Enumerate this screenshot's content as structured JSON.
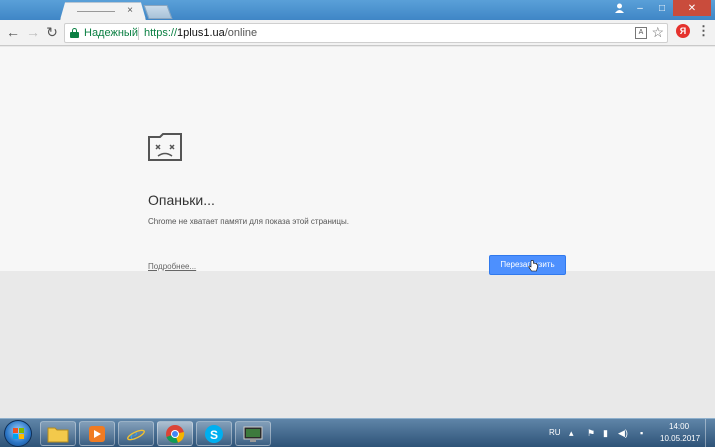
{
  "browser": {
    "tab": {
      "title": "",
      "close_glyph": "×"
    },
    "window_controls": {
      "minimize": "–",
      "maximize": "□",
      "close": "✕"
    },
    "omnibox": {
      "secure_label": "Надежный",
      "url_scheme": "https://",
      "url_host": "1plus1.ua",
      "url_path": "/online"
    },
    "extension_badge": "Я"
  },
  "page": {
    "title": "Опаньки...",
    "message": "Chrome не хватает памяти для показа этой страницы.",
    "details_link": "Подробнее...",
    "reload_button": "Перезагрузить"
  },
  "taskbar": {
    "apps": [
      {
        "name": "explorer",
        "icon": "folder-icon"
      },
      {
        "name": "media-player",
        "icon": "play-icon"
      },
      {
        "name": "internet-explorer",
        "icon": "ie-icon"
      },
      {
        "name": "chrome",
        "icon": "chrome-icon"
      },
      {
        "name": "skype",
        "icon": "skype-icon"
      },
      {
        "name": "desktop",
        "icon": "monitor-icon"
      }
    ],
    "tray": {
      "language": "RU",
      "time": "14:00",
      "date": "10.05.2017"
    }
  },
  "colors": {
    "secure_green": "#0b8043",
    "button_blue": "#4d90fe",
    "titlebar": "#3f86c6",
    "taskbar": "#2e5378"
  }
}
